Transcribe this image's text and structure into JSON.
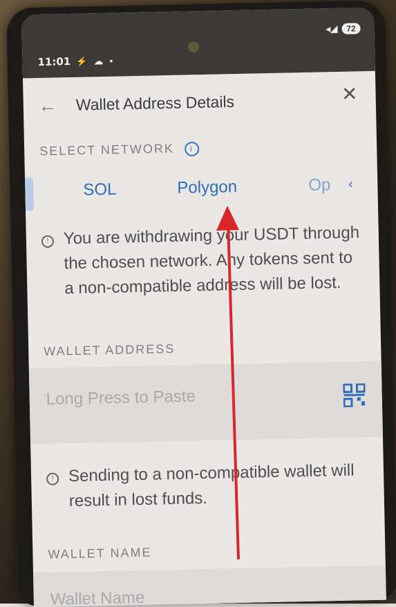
{
  "status_bar": {
    "time": "11:01",
    "battery": "72"
  },
  "header": {
    "title": "Wallet Address Details"
  },
  "network": {
    "label": "SELECT NETWORK",
    "tabs": [
      "SOL",
      "Polygon",
      "Op"
    ]
  },
  "notice1": "You are withdrawing your USDT through the chosen network. Any tokens sent to a non-compatible address will be lost.",
  "wallet_address": {
    "label": "WALLET ADDRESS",
    "placeholder": "Long Press to Paste"
  },
  "notice2": "Sending to a non-compatible wallet will result in lost funds.",
  "wallet_name": {
    "label": "WALLET NAME",
    "placeholder": "Wallet Name"
  },
  "colors": {
    "accent": "#2e6dbd",
    "arrow": "#d8262b"
  },
  "icons": [
    "back-arrow-icon",
    "close-icon",
    "info-icon",
    "qr-code-icon"
  ]
}
